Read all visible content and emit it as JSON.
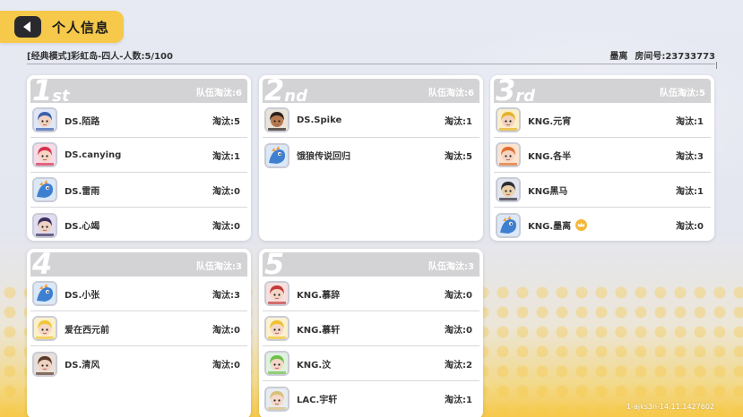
{
  "header": {
    "title": "个人信息"
  },
  "match": {
    "mode": "[经典模式]彩虹岛-四人-人数:5/100",
    "host": "墨离",
    "room": "房间号:23733773"
  },
  "teams": [
    {
      "rank_num": "1",
      "rank_suffix": "st",
      "team_elim": "队伍淘汰:6",
      "players": [
        {
          "name": "DS.陌路",
          "kills": "淘汰:5",
          "avatar": "blue-armor"
        },
        {
          "name": "DS.canying",
          "kills": "淘汰:1",
          "avatar": "pink-red"
        },
        {
          "name": "DS.雷雨",
          "kills": "淘汰:0",
          "avatar": "blue-dragon"
        },
        {
          "name": "DS.心竭",
          "kills": "淘汰:0",
          "avatar": "dark-purple"
        }
      ]
    },
    {
      "rank_num": "2",
      "rank_suffix": "nd",
      "team_elim": "队伍淘汰:6",
      "players": [
        {
          "name": "DS.Spike",
          "kills": "淘汰:1",
          "avatar": "curly-hair"
        },
        {
          "name": "饿狼传说回归",
          "kills": "淘汰:5",
          "avatar": "blue-dragon"
        }
      ]
    },
    {
      "rank_num": "3",
      "rank_suffix": "rd",
      "team_elim": "队伍淘汰:5",
      "players": [
        {
          "name": "KNG.元宵",
          "kills": "淘汰:1",
          "avatar": "yellow-king"
        },
        {
          "name": "KNG.各半",
          "kills": "淘汰:3",
          "avatar": "orange-hair"
        },
        {
          "name": "KNG黑马",
          "kills": "淘汰:1",
          "avatar": "black-horse"
        },
        {
          "name": "KNG.墨离",
          "kills": "淘汰:0",
          "avatar": "blue-dragon",
          "crown": true
        }
      ]
    },
    {
      "rank_num": "4",
      "rank_suffix": "",
      "team_elim": "队伍淘汰:3",
      "players": [
        {
          "name": "DS.小张",
          "kills": "淘汰:3",
          "avatar": "blue-dragon"
        },
        {
          "name": "爱在西元前",
          "kills": "淘汰:0",
          "avatar": "yellow-blonde"
        },
        {
          "name": "DS.清风",
          "kills": "淘汰:0",
          "avatar": "brown-hair"
        }
      ]
    },
    {
      "rank_num": "5",
      "rank_suffix": "",
      "team_elim": "队伍淘汰:3",
      "players": [
        {
          "name": "KNG.慕辞",
          "kills": "淘汰:0",
          "avatar": "red-girl"
        },
        {
          "name": "KNG.慕轩",
          "kills": "淘汰:0",
          "avatar": "yellow-cap"
        },
        {
          "name": "KNG.汶",
          "kills": "淘汰:2",
          "avatar": "green-hair"
        },
        {
          "name": "LAC.宇轩",
          "kills": "淘汰:1",
          "avatar": "glasses"
        }
      ]
    }
  ],
  "footer": {
    "version": "1-ajks3n-14.11.1427602"
  },
  "colors": {
    "accent": "#f6c94a",
    "card_header": "#d3d3d5"
  }
}
